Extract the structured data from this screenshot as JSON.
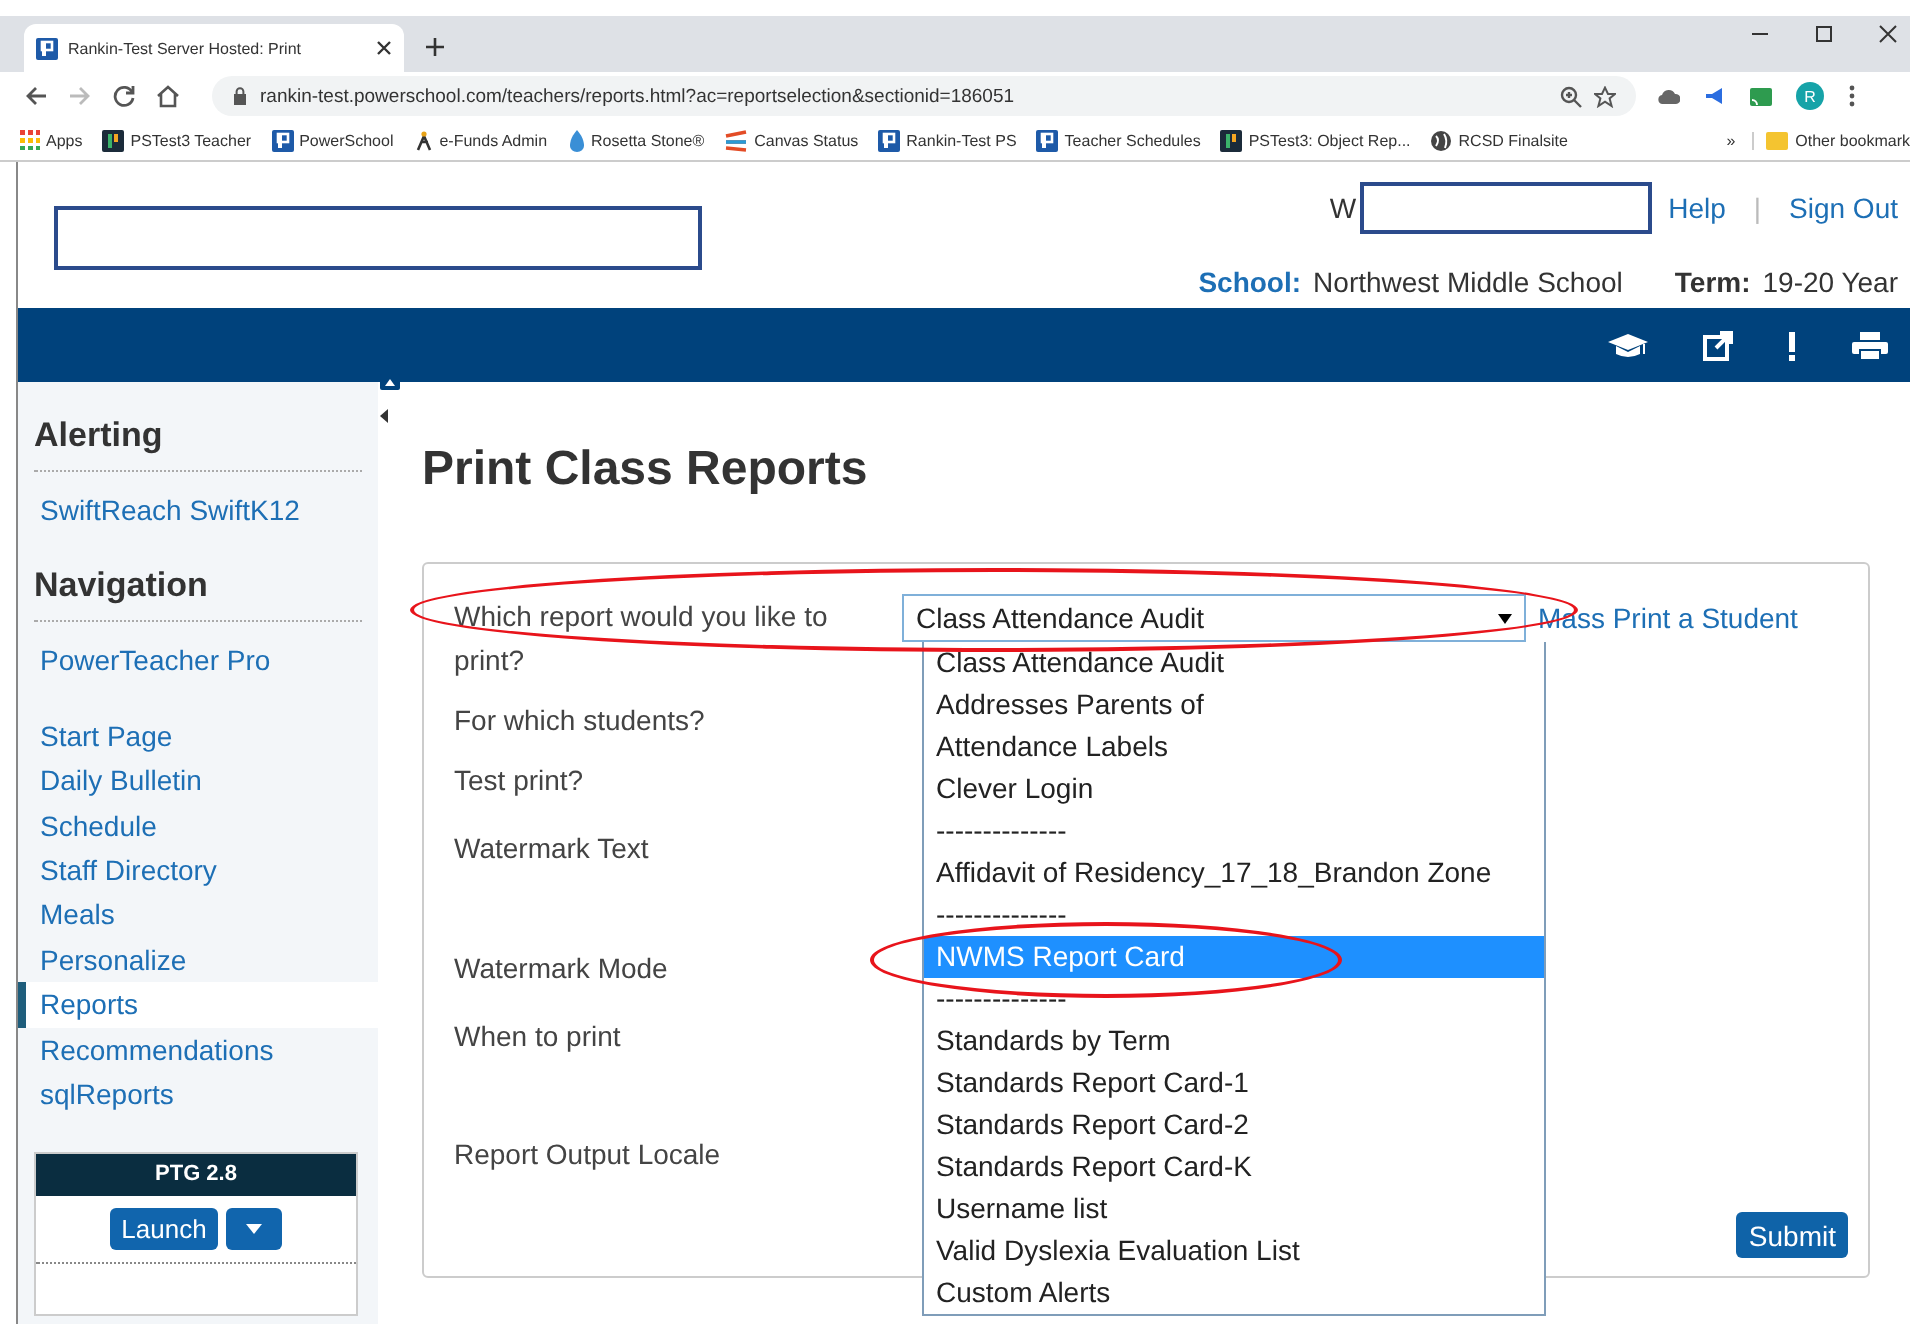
{
  "browser": {
    "tab_title": "Rankin-Test Server Hosted: Print",
    "url": "rankin-test.powerschool.com/teachers/reports.html?ac=reportselection&sectionid=186051",
    "avatar": "R",
    "bookmarks": [
      {
        "label": "Apps",
        "kind": "apps"
      },
      {
        "label": "PSTest3 Teacher",
        "kind": "ps-dark"
      },
      {
        "label": "PowerSchool",
        "kind": "ps"
      },
      {
        "label": "e-Funds Admin",
        "kind": "efunds"
      },
      {
        "label": "Rosetta Stone®",
        "kind": "rosetta"
      },
      {
        "label": "Canvas Status",
        "kind": "canvas"
      },
      {
        "label": "Rankin-Test PS",
        "kind": "ps"
      },
      {
        "label": "Teacher Schedules",
        "kind": "ps"
      },
      {
        "label": "PSTest3: Object Rep...",
        "kind": "ps-dark"
      },
      {
        "label": "RCSD Finalsite",
        "kind": "globe"
      }
    ],
    "more": "»",
    "other_bookmarks": "Other bookmark"
  },
  "header": {
    "logo_redacted": true,
    "user_prefix": "W",
    "user_redacted": true,
    "links": [
      "Help",
      "Sign Out"
    ],
    "separator": "|",
    "school_label": "School:",
    "school": "Northwest Middle School",
    "term_label": "Term:",
    "term": "19-20 Year"
  },
  "sidebar": {
    "sections": [
      {
        "heading": "Alerting",
        "items": [
          {
            "label": "SwiftReach SwiftK12",
            "selected": false
          }
        ]
      },
      {
        "heading": "Navigation",
        "items": [
          {
            "label": "PowerTeacher Pro",
            "selected": false
          }
        ]
      }
    ],
    "nav_items": [
      {
        "label": "Start Page",
        "selected": false
      },
      {
        "label": "Daily Bulletin",
        "selected": false
      },
      {
        "label": "Schedule",
        "selected": false
      },
      {
        "label": "Staff Directory",
        "selected": false
      },
      {
        "label": "Meals",
        "selected": false
      },
      {
        "label": "Personalize",
        "selected": false
      },
      {
        "label": "Reports",
        "selected": true
      },
      {
        "label": "Recommendations",
        "selected": false
      },
      {
        "label": "sqlReports",
        "selected": false
      }
    ],
    "widget": {
      "title": "PTG 2.8",
      "button": "Launch"
    }
  },
  "main": {
    "title": "Print Class Reports",
    "labels": [
      "Which report would you like to print?",
      "For which students?",
      "Test print?",
      "Watermark Text",
      "Watermark Mode",
      "When to print",
      "Report Output Locale"
    ],
    "select_value": "Class Attendance Audit",
    "link": "Mass Print a Student",
    "submit": "Submit",
    "options": [
      {
        "label": "Class Attendance Audit",
        "selected": false
      },
      {
        "label": "Addresses Parents of",
        "selected": false
      },
      {
        "label": "Attendance Labels",
        "selected": false
      },
      {
        "label": "Clever Login",
        "selected": false
      },
      {
        "label": "--------------",
        "selected": false
      },
      {
        "label": "Affidavit of Residency_17_18_Brandon Zone",
        "selected": false
      },
      {
        "label": "--------------",
        "selected": false
      },
      {
        "label": "NWMS Report Card",
        "selected": true
      },
      {
        "label": "--------------",
        "selected": false
      },
      {
        "label": "Standards by Term",
        "selected": false
      },
      {
        "label": "Standards Report Card-1",
        "selected": false
      },
      {
        "label": "Standards Report Card-2",
        "selected": false
      },
      {
        "label": "Standards Report Card-K",
        "selected": false
      },
      {
        "label": "Username list",
        "selected": false
      },
      {
        "label": "Valid Dyslexia Evaluation List",
        "selected": false
      },
      {
        "label": "Custom Alerts",
        "selected": false
      }
    ]
  },
  "annotations": [
    {
      "kind": "ellipse"
    },
    {
      "kind": "ellipse"
    }
  ]
}
